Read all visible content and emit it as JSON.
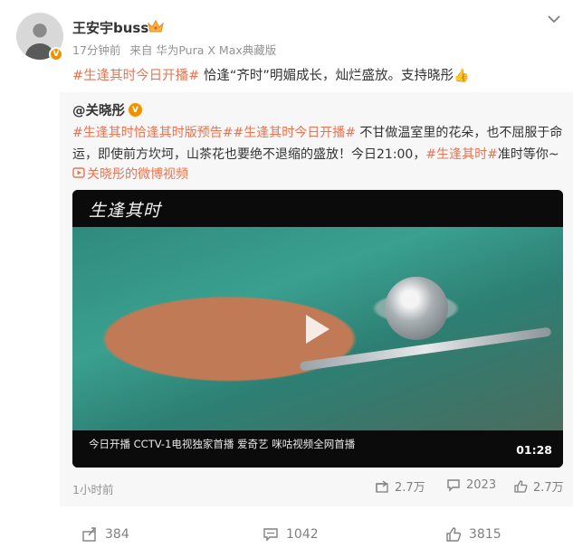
{
  "post": {
    "author": "王安宇buss",
    "time": "17分钟前",
    "source": "来自 华为Pura X Max典藏版",
    "topic": "#生逢其时今日开播#",
    "text": " 恰逢“齐时”明媚成长，灿烂盛放。支持晓彤",
    "emoji": "👍"
  },
  "repost": {
    "author": "@关晓彤",
    "line1_topics": "#生逢其时恰逢其时版预告##生逢其时今日开播#",
    "line1_text": " 不甘做温室里的花朵，也不屈服于命",
    "line2_text": "运，即使前方坎坷，山茶花也要绝不退缩的盛放！今日21:00，",
    "line2_topic": "#生逢其时#",
    "line2_tail": "准时等你~",
    "video_link": "关晓彤的微博视频",
    "video": {
      "logo": "生逢其时",
      "caption": "今日开播 CCTV-1电视独家首播 爱奇艺 咪咕视频全网首播",
      "duration": "01:28"
    },
    "time": "1小时前",
    "stats": {
      "repost": "2.7万",
      "comment": "2023",
      "like": "2.7万"
    }
  },
  "actions": {
    "repost": "384",
    "comment": "1042",
    "like": "3815"
  },
  "icons": {
    "crown": "crown-icon",
    "more": "chevron-down-icon",
    "verified": "verified-badge-icon",
    "link": "video-link-icon",
    "play": "play-icon",
    "repost": "repost-icon",
    "comment": "comment-icon",
    "like": "like-icon"
  },
  "colors": {
    "topic": "#eb7350",
    "badge": "#f29100",
    "muted": "#939393"
  }
}
